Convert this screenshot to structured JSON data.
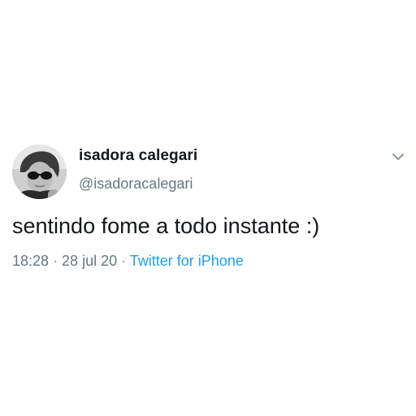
{
  "tweet": {
    "display_name": "isadora calegari",
    "handle": "@isadoracalegari",
    "text": "sentindo fome a todo instante :)",
    "time": "18:28",
    "date": "28 jul 20",
    "separator": " · ",
    "source": "Twitter for iPhone"
  },
  "icons": {
    "avatar": "user-avatar-photo",
    "menu": "chevron-down-icon"
  },
  "colors": {
    "text_primary": "#14171a",
    "text_secondary": "#657786",
    "link": "#1da1f2",
    "chevron": "#8899a6"
  }
}
